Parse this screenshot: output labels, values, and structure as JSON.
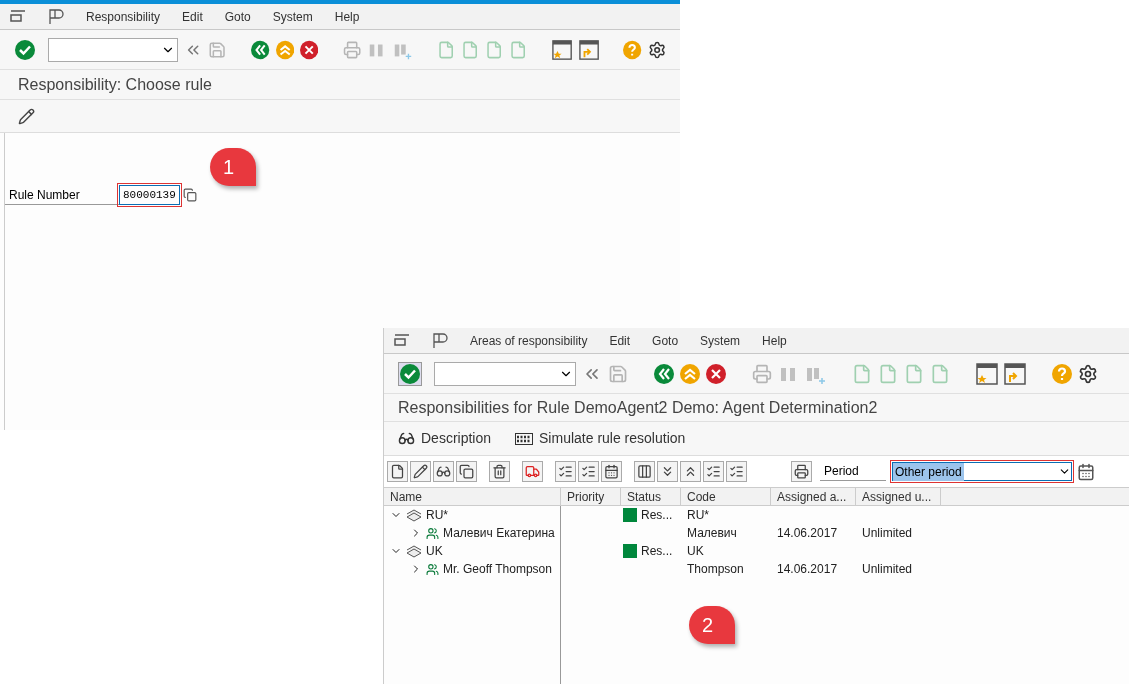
{
  "window_1": {
    "menu": [
      "Responsibility",
      "Edit",
      "Goto",
      "System",
      "Help"
    ],
    "title": "Responsibility: Choose rule",
    "field": {
      "label": "Rule Number",
      "value": "80000139"
    },
    "callout": "1"
  },
  "window_2": {
    "menu": [
      "Areas of responsibility",
      "Edit",
      "Goto",
      "System",
      "Help"
    ],
    "title": "Responsibilities for Rule DemoAgent2 Demo: Agent Determination2",
    "actions": [
      "Description",
      "Simulate rule resolution"
    ],
    "period": {
      "label": "Period",
      "value": "Other period"
    },
    "table": {
      "columns": [
        "Name",
        "Priority",
        "Status",
        "Code",
        "Assigned a...",
        "Assigned u..."
      ],
      "rows": [
        {
          "name": "RU*",
          "expanded": true,
          "status": {
            "text": "Res...",
            "color": "#00873c"
          },
          "code": "RU*",
          "children": [
            {
              "name": "Малевич Екатерина",
              "expanded": false,
              "code": "Малевич",
              "assigned_from": "14.06.2017",
              "assigned_until": "Unlimited"
            }
          ]
        },
        {
          "name": "UK",
          "expanded": true,
          "status": {
            "text": "Res...",
            "color": "#00873c"
          },
          "code": "UK",
          "children": [
            {
              "name": "Mr. Geoff Thompson",
              "expanded": false,
              "code": "Thompson",
              "assigned_from": "14.06.2017",
              "assigned_until": "Unlimited"
            }
          ]
        }
      ]
    },
    "callout": "2"
  }
}
